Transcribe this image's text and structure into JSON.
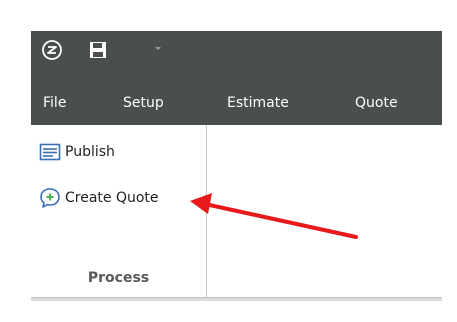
{
  "menu": {
    "file": "File",
    "setup": "Setup",
    "estimate": "Estimate",
    "quote": "Quote"
  },
  "ribbon": {
    "publish_label": "Publish",
    "create_quote_label": "Create Quote",
    "group_label": "Process"
  },
  "icons": {
    "logo": "app-logo-icon",
    "save": "floppy-disk-icon",
    "qat": "chevron-down-icon",
    "publish": "publish-list-icon",
    "create_quote": "speech-bubble-plus-icon"
  },
  "colors": {
    "title_bar": "#4a4e4d",
    "annotation_arrow": "#e8191b",
    "icon_blue": "#3a6fb5",
    "icon_green": "#4caf50"
  }
}
